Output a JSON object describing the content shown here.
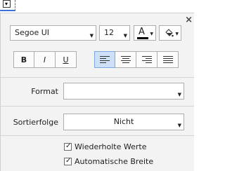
{
  "formatting_panel": {
    "close_glyph": "×",
    "font": {
      "name": "Segoe UI",
      "size": "12"
    },
    "font_color_letter": "A",
    "font_color": "#000000",
    "style_buttons": {
      "bold": "B",
      "italic": "I",
      "underline": "U"
    },
    "alignment": {
      "selected": "left"
    },
    "format": {
      "label": "Format",
      "value": ""
    },
    "sort_order": {
      "label": "Sortierfolge",
      "value": "Nicht"
    },
    "checkboxes": [
      {
        "label": "Wiederholte Werte",
        "checked": true
      },
      {
        "label": "Automatische Breite",
        "checked": true
      }
    ],
    "accent_color": "#cde0f7"
  }
}
